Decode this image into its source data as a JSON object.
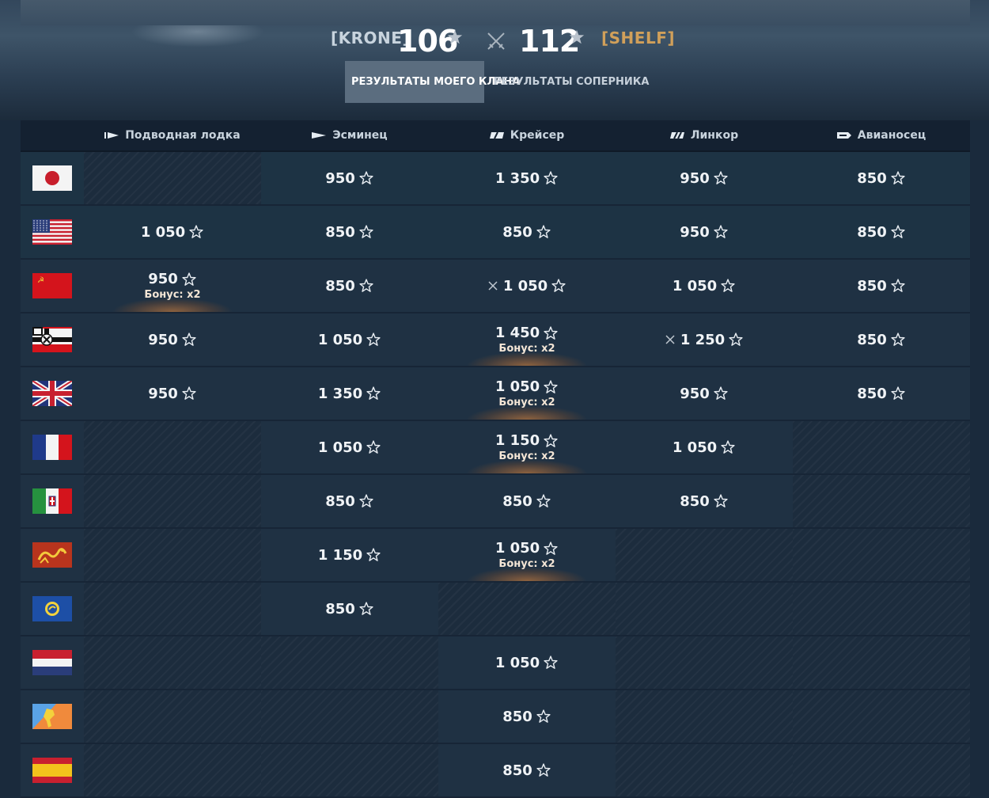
{
  "header": {
    "my_clan": "[KRONE]",
    "my_score": "106",
    "enemy_clan": "[SHELF]",
    "enemy_score": "112"
  },
  "tabs": [
    {
      "label": "РЕЗУЛЬТАТЫ МОЕГО КЛАНА",
      "active": true
    },
    {
      "label": "РЕЗУЛЬТАТЫ СОПЕРНИКА",
      "active": false
    }
  ],
  "columns": [
    "Подводная лодка",
    "Эсминец",
    "Крейсер",
    "Линкор",
    "Авианосец"
  ],
  "bonus_label": "Бонус: x2",
  "rows": [
    {
      "nation": "japan-flag",
      "cells": [
        null,
        {
          "v": "950"
        },
        {
          "v": "1 350"
        },
        {
          "v": "950"
        },
        {
          "v": "850"
        }
      ]
    },
    {
      "nation": "usa-flag",
      "cells": [
        {
          "v": "1 050"
        },
        {
          "v": "850"
        },
        {
          "v": "850"
        },
        {
          "v": "950"
        },
        {
          "v": "850"
        }
      ]
    },
    {
      "nation": "ussr-flag",
      "cells": [
        {
          "v": "950",
          "bonus": true
        },
        {
          "v": "850"
        },
        {
          "v": "1 050",
          "attack": true
        },
        {
          "v": "1 050"
        },
        {
          "v": "850"
        }
      ]
    },
    {
      "nation": "germany-flag",
      "cells": [
        {
          "v": "950"
        },
        {
          "v": "1 050"
        },
        {
          "v": "1 450",
          "bonus": true
        },
        {
          "v": "1 250",
          "attack": true
        },
        {
          "v": "850"
        }
      ]
    },
    {
      "nation": "uk-flag",
      "cells": [
        {
          "v": "950"
        },
        {
          "v": "1 350"
        },
        {
          "v": "1 050",
          "bonus": true
        },
        {
          "v": "950"
        },
        {
          "v": "850"
        }
      ]
    },
    {
      "nation": "france-flag",
      "cells": [
        null,
        {
          "v": "1 050"
        },
        {
          "v": "1 150",
          "bonus": true
        },
        {
          "v": "1 050"
        },
        null
      ]
    },
    {
      "nation": "italy-flag",
      "cells": [
        null,
        {
          "v": "850"
        },
        {
          "v": "850"
        },
        {
          "v": "850"
        },
        null
      ]
    },
    {
      "nation": "pan-asia-flag",
      "cells": [
        null,
        {
          "v": "1 150"
        },
        {
          "v": "1 050",
          "bonus": true
        },
        null,
        null
      ]
    },
    {
      "nation": "europe-flag",
      "cells": [
        null,
        {
          "v": "850"
        },
        null,
        null,
        null
      ]
    },
    {
      "nation": "netherlands-flag",
      "cells": [
        null,
        null,
        {
          "v": "1 050"
        },
        null,
        null
      ]
    },
    {
      "nation": "pan-america-flag",
      "cells": [
        null,
        null,
        {
          "v": "850"
        },
        null,
        null
      ]
    },
    {
      "nation": "spain-flag",
      "cells": [
        null,
        null,
        {
          "v": "850"
        },
        null,
        null
      ]
    }
  ],
  "colors": {
    "enemy_clan": "#d1a05a",
    "active_tab": "#5b6d7f",
    "background": "#1a2a3c"
  }
}
